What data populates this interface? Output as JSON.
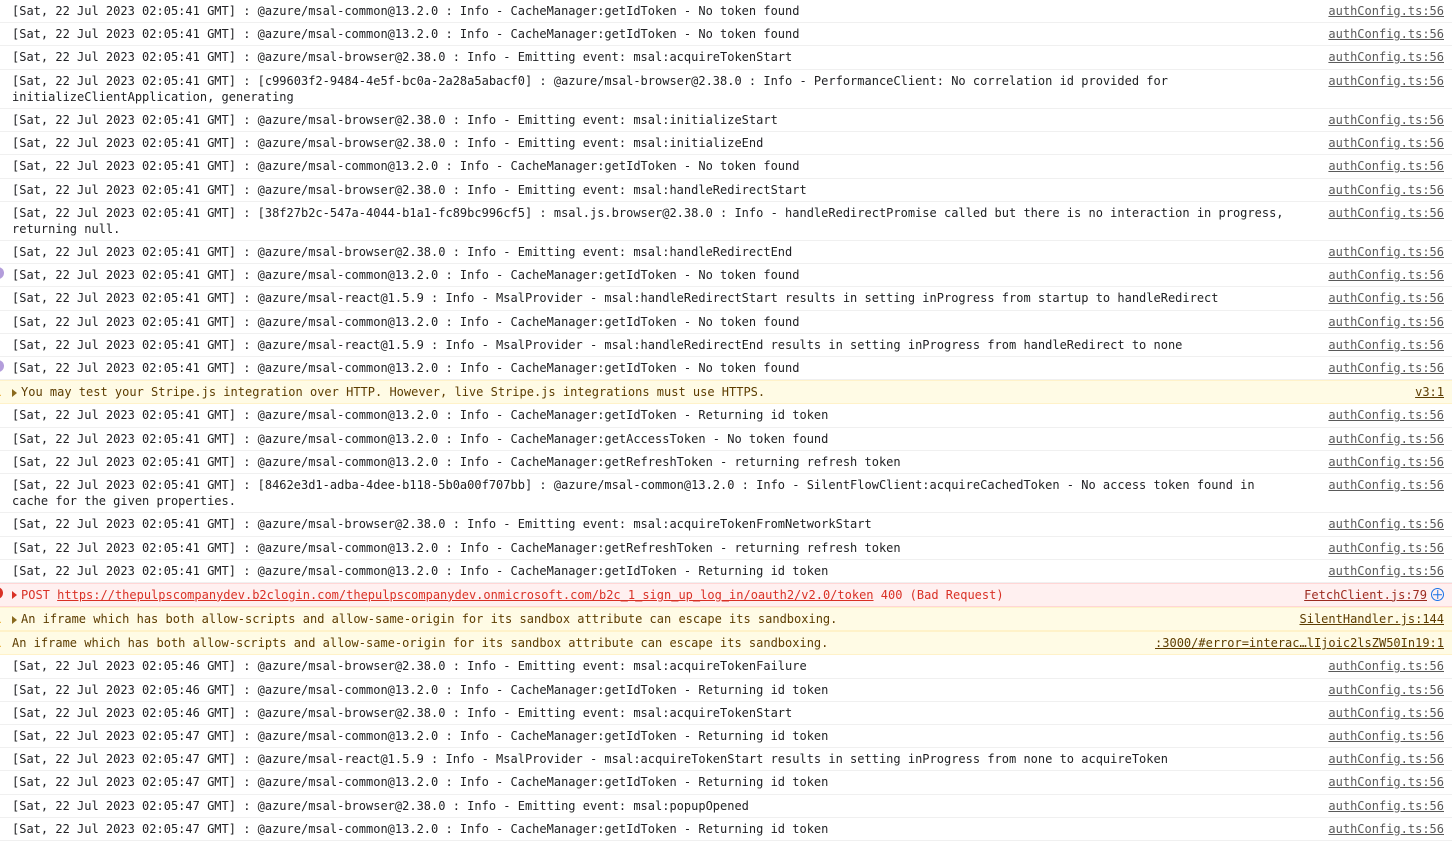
{
  "console": {
    "rows": [
      {
        "level": "info",
        "gutter": "none",
        "disclosure": false,
        "text": "[Sat, 22 Jul 2023 02:05:41 GMT] : @azure/msal-common@13.2.0 : Info - CacheManager:getIdToken - No token found",
        "source": "authConfig.ts:56",
        "badge": "none"
      },
      {
        "level": "info",
        "gutter": "none",
        "disclosure": false,
        "text": "[Sat, 22 Jul 2023 02:05:41 GMT] : @azure/msal-common@13.2.0 : Info - CacheManager:getIdToken - No token found",
        "source": "authConfig.ts:56",
        "badge": "none"
      },
      {
        "level": "info",
        "gutter": "none",
        "disclosure": false,
        "text": "[Sat, 22 Jul 2023 02:05:41 GMT] : @azure/msal-browser@2.38.0 : Info - Emitting event: msal:acquireTokenStart",
        "source": "authConfig.ts:56",
        "badge": "none"
      },
      {
        "level": "info",
        "gutter": "none",
        "disclosure": false,
        "text": "[Sat, 22 Jul 2023 02:05:41 GMT] : [c99603f2-9484-4e5f-bc0a-2a28a5abacf0] : @azure/msal-browser@2.38.0 : Info - PerformanceClient: No correlation id provided for initializeClientApplication, generating",
        "source": "authConfig.ts:56",
        "badge": "none"
      },
      {
        "level": "info",
        "gutter": "none",
        "disclosure": false,
        "text": "[Sat, 22 Jul 2023 02:05:41 GMT] : @azure/msal-browser@2.38.0 : Info - Emitting event: msal:initializeStart",
        "source": "authConfig.ts:56",
        "badge": "none"
      },
      {
        "level": "info",
        "gutter": "none",
        "disclosure": false,
        "text": "[Sat, 22 Jul 2023 02:05:41 GMT] : @azure/msal-browser@2.38.0 : Info - Emitting event: msal:initializeEnd",
        "source": "authConfig.ts:56",
        "badge": "none"
      },
      {
        "level": "info",
        "gutter": "none",
        "disclosure": false,
        "text": "[Sat, 22 Jul 2023 02:05:41 GMT] : @azure/msal-common@13.2.0 : Info - CacheManager:getIdToken - No token found",
        "source": "authConfig.ts:56",
        "badge": "none"
      },
      {
        "level": "info",
        "gutter": "none",
        "disclosure": false,
        "text": "[Sat, 22 Jul 2023 02:05:41 GMT] : @azure/msal-browser@2.38.0 : Info - Emitting event: msal:handleRedirectStart",
        "source": "authConfig.ts:56",
        "badge": "none"
      },
      {
        "level": "info",
        "gutter": "none",
        "disclosure": false,
        "text": "[Sat, 22 Jul 2023 02:05:41 GMT] : [38f27b2c-547a-4044-b1a1-fc89bc996cf5] : msal.js.browser@2.38.0 : Info - handleRedirectPromise called but there is no interaction in progress, returning null.",
        "source": "authConfig.ts:56",
        "badge": "none"
      },
      {
        "level": "info",
        "gutter": "none",
        "disclosure": false,
        "text": "[Sat, 22 Jul 2023 02:05:41 GMT] : @azure/msal-browser@2.38.0 : Info - Emitting event: msal:handleRedirectEnd",
        "source": "authConfig.ts:56",
        "badge": "none"
      },
      {
        "level": "info",
        "gutter": "violation",
        "disclosure": false,
        "text": "[Sat, 22 Jul 2023 02:05:41 GMT] : @azure/msal-common@13.2.0 : Info - CacheManager:getIdToken - No token found",
        "source": "authConfig.ts:56",
        "badge": "none"
      },
      {
        "level": "info",
        "gutter": "none",
        "disclosure": false,
        "text": "[Sat, 22 Jul 2023 02:05:41 GMT] : @azure/msal-react@1.5.9 : Info - MsalProvider - msal:handleRedirectStart results in setting inProgress from startup to handleRedirect",
        "source": "authConfig.ts:56",
        "badge": "none"
      },
      {
        "level": "info",
        "gutter": "none",
        "disclosure": false,
        "text": "[Sat, 22 Jul 2023 02:05:41 GMT] : @azure/msal-common@13.2.0 : Info - CacheManager:getIdToken - No token found",
        "source": "authConfig.ts:56",
        "badge": "none"
      },
      {
        "level": "info",
        "gutter": "none",
        "disclosure": false,
        "text": "[Sat, 22 Jul 2023 02:05:41 GMT] : @azure/msal-react@1.5.9 : Info - MsalProvider - msal:handleRedirectEnd results in setting inProgress from handleRedirect to none",
        "source": "authConfig.ts:56",
        "badge": "none"
      },
      {
        "level": "info",
        "gutter": "violation",
        "disclosure": false,
        "text": "[Sat, 22 Jul 2023 02:05:41 GMT] : @azure/msal-common@13.2.0 : Info - CacheManager:getIdToken - No token found",
        "source": "authConfig.ts:56",
        "badge": "none"
      },
      {
        "level": "warn",
        "gutter": "warning",
        "disclosure": true,
        "text": "You may test your Stripe.js integration over HTTP. However, live Stripe.js integrations must use HTTPS.",
        "source": "v3:1",
        "badge": "none"
      },
      {
        "level": "info",
        "gutter": "none",
        "disclosure": false,
        "text": "[Sat, 22 Jul 2023 02:05:41 GMT] : @azure/msal-common@13.2.0 : Info - CacheManager:getIdToken - Returning id token",
        "source": "authConfig.ts:56",
        "badge": "none"
      },
      {
        "level": "info",
        "gutter": "none",
        "disclosure": false,
        "text": "[Sat, 22 Jul 2023 02:05:41 GMT] : @azure/msal-common@13.2.0 : Info - CacheManager:getAccessToken - No token found",
        "source": "authConfig.ts:56",
        "badge": "none"
      },
      {
        "level": "info",
        "gutter": "none",
        "disclosure": false,
        "text": "[Sat, 22 Jul 2023 02:05:41 GMT] : @azure/msal-common@13.2.0 : Info - CacheManager:getRefreshToken - returning refresh token",
        "source": "authConfig.ts:56",
        "badge": "none"
      },
      {
        "level": "info",
        "gutter": "none",
        "disclosure": false,
        "text": "[Sat, 22 Jul 2023 02:05:41 GMT] : [8462e3d1-adba-4dee-b118-5b0a00f707bb] : @azure/msal-common@13.2.0 : Info - SilentFlowClient:acquireCachedToken - No access token found in cache for the given properties.",
        "source": "authConfig.ts:56",
        "badge": "none"
      },
      {
        "level": "info",
        "gutter": "none",
        "disclosure": false,
        "text": "[Sat, 22 Jul 2023 02:05:41 GMT] : @azure/msal-browser@2.38.0 : Info - Emitting event: msal:acquireTokenFromNetworkStart",
        "source": "authConfig.ts:56",
        "badge": "none"
      },
      {
        "level": "info",
        "gutter": "none",
        "disclosure": false,
        "text": "[Sat, 22 Jul 2023 02:05:41 GMT] : @azure/msal-common@13.2.0 : Info - CacheManager:getRefreshToken - returning refresh token",
        "source": "authConfig.ts:56",
        "badge": "none"
      },
      {
        "level": "info",
        "gutter": "none",
        "disclosure": false,
        "text": "[Sat, 22 Jul 2023 02:05:41 GMT] : @azure/msal-common@13.2.0 : Info - CacheManager:getIdToken - Returning id token",
        "source": "authConfig.ts:56",
        "badge": "none"
      },
      {
        "level": "error",
        "gutter": "error",
        "disclosure": true,
        "kind": "network",
        "method": "POST",
        "url": "https://thepulpscompanydev.b2clogin.com/thepulpscompanydev.onmicrosoft.com/b2c_1_sign_up_log_in/oauth2/v2.0/token",
        "status": "400 (Bad Request)",
        "source": "FetchClient.js:79",
        "badge": "network-request-icon"
      },
      {
        "level": "warn",
        "gutter": "warning",
        "disclosure": true,
        "text": "An iframe which has both allow-scripts and allow-same-origin for its sandbox attribute can escape its sandboxing.",
        "source": "SilentHandler.js:144",
        "badge": "none"
      },
      {
        "level": "warn",
        "gutter": "warning",
        "disclosure": false,
        "text": "An iframe which has both allow-scripts and allow-same-origin for its sandbox attribute can escape its sandboxing.",
        "source": ":3000/#error=interac…lIjoic2lsZW50In19:1",
        "badge": "none"
      },
      {
        "level": "info",
        "gutter": "none",
        "disclosure": false,
        "text": "[Sat, 22 Jul 2023 02:05:46 GMT] : @azure/msal-browser@2.38.0 : Info - Emitting event: msal:acquireTokenFailure",
        "source": "authConfig.ts:56",
        "badge": "none"
      },
      {
        "level": "info",
        "gutter": "none",
        "disclosure": false,
        "text": "[Sat, 22 Jul 2023 02:05:46 GMT] : @azure/msal-common@13.2.0 : Info - CacheManager:getIdToken - Returning id token",
        "source": "authConfig.ts:56",
        "badge": "none"
      },
      {
        "level": "info",
        "gutter": "none",
        "disclosure": false,
        "text": "[Sat, 22 Jul 2023 02:05:46 GMT] : @azure/msal-browser@2.38.0 : Info - Emitting event: msal:acquireTokenStart",
        "source": "authConfig.ts:56",
        "badge": "none"
      },
      {
        "level": "info",
        "gutter": "none",
        "disclosure": false,
        "text": "[Sat, 22 Jul 2023 02:05:47 GMT] : @azure/msal-common@13.2.0 : Info - CacheManager:getIdToken - Returning id token",
        "source": "authConfig.ts:56",
        "badge": "none"
      },
      {
        "level": "info",
        "gutter": "none",
        "disclosure": false,
        "text": "[Sat, 22 Jul 2023 02:05:47 GMT] : @azure/msal-react@1.5.9 : Info - MsalProvider - msal:acquireTokenStart results in setting inProgress from none to acquireToken",
        "source": "authConfig.ts:56",
        "badge": "none"
      },
      {
        "level": "info",
        "gutter": "none",
        "disclosure": false,
        "text": "[Sat, 22 Jul 2023 02:05:47 GMT] : @azure/msal-common@13.2.0 : Info - CacheManager:getIdToken - Returning id token",
        "source": "authConfig.ts:56",
        "badge": "none"
      },
      {
        "level": "info",
        "gutter": "none",
        "disclosure": false,
        "text": "[Sat, 22 Jul 2023 02:05:47 GMT] : @azure/msal-browser@2.38.0 : Info - Emitting event: msal:popupOpened",
        "source": "authConfig.ts:56",
        "badge": "none"
      },
      {
        "level": "info",
        "gutter": "none",
        "disclosure": false,
        "text": "[Sat, 22 Jul 2023 02:05:47 GMT] : @azure/msal-common@13.2.0 : Info - CacheManager:getIdToken - Returning id token",
        "source": "authConfig.ts:56",
        "badge": "none"
      }
    ]
  },
  "colors": {
    "info_bg": "#ffffff",
    "warn_bg": "#fffbe5",
    "error_bg": "#fff0f0",
    "error_text": "#d93025",
    "warn_text": "#5c3c00",
    "link": "#5a5a5a",
    "network_icon": "#1a73e8",
    "violation_icon": "#b39ddb"
  }
}
